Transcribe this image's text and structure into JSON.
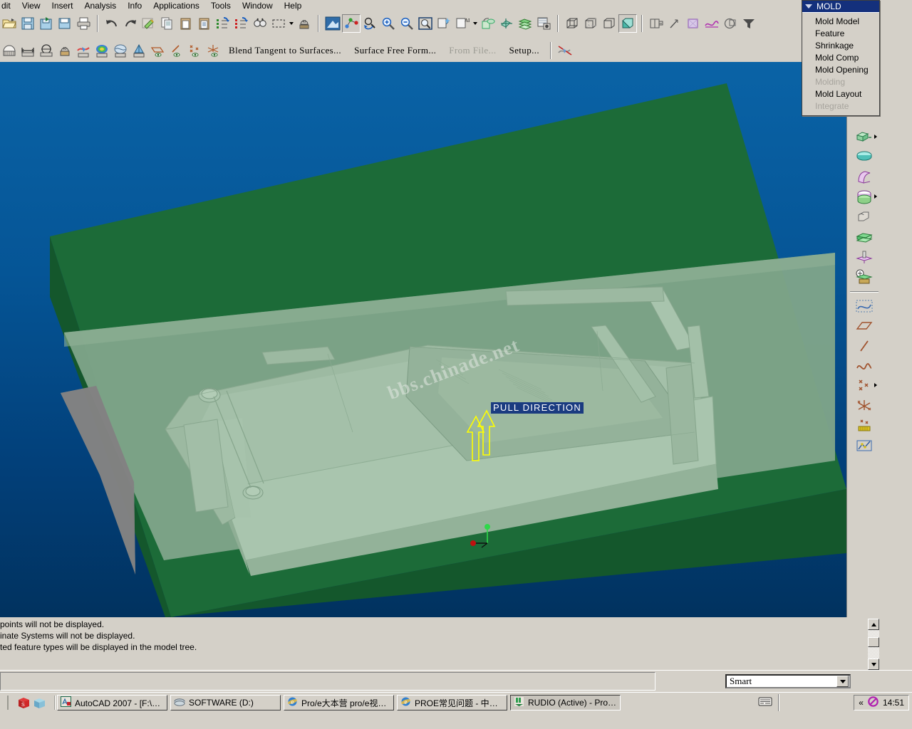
{
  "menubar": {
    "items": [
      {
        "label": "dit",
        "accel": ""
      },
      {
        "label": "View",
        "accel": "V"
      },
      {
        "label": "Insert",
        "accel": "I"
      },
      {
        "label": "Analysis",
        "accel": "A"
      },
      {
        "label": "Info",
        "accel": "n"
      },
      {
        "label": "Applications",
        "accel": "p"
      },
      {
        "label": "Tools",
        "accel": "T"
      },
      {
        "label": "Window",
        "accel": "W"
      },
      {
        "label": "Help",
        "accel": "H"
      }
    ]
  },
  "toolbar_top": {
    "icons": [
      {
        "name": "open-icon"
      },
      {
        "name": "save-icon"
      },
      {
        "name": "save-as-icon"
      },
      {
        "name": "save-copy-icon"
      },
      {
        "name": "print-icon"
      },
      {
        "name": "undo-icon"
      },
      {
        "name": "redo-icon"
      },
      {
        "name": "cut-icon"
      },
      {
        "name": "copy-icon"
      },
      {
        "name": "paste-icon"
      },
      {
        "name": "paste-special-icon"
      },
      {
        "name": "regenerate-icon"
      },
      {
        "name": "regenerate-manual-icon"
      },
      {
        "name": "find-icon"
      },
      {
        "name": "select-box-icon"
      },
      {
        "name": "measure-icon"
      },
      {
        "name": "repaint-icon"
      },
      {
        "name": "spin-center-icon"
      },
      {
        "name": "reorient-icon"
      },
      {
        "name": "zoom-in-icon"
      },
      {
        "name": "zoom-out-icon"
      },
      {
        "name": "refit-icon"
      },
      {
        "name": "saved-view-icon"
      },
      {
        "name": "annotation-icon"
      },
      {
        "name": "layer-icon"
      },
      {
        "name": "appearance-icon"
      },
      {
        "name": "view-manager-icon"
      },
      {
        "name": "render-icon"
      },
      {
        "name": "wireframe-icon"
      },
      {
        "name": "hidden-line-icon"
      },
      {
        "name": "no-hidden-icon"
      },
      {
        "name": "shaded-icon"
      },
      {
        "name": "datum-plane-icon"
      },
      {
        "name": "datum-axis-icon"
      },
      {
        "name": "datum-point-icon"
      },
      {
        "name": "datum-csys-icon"
      },
      {
        "name": "annotation-toggle-icon"
      },
      {
        "name": "filter-icon"
      }
    ]
  },
  "toolbar_second": {
    "icons": [
      {
        "name": "curvature-icon"
      },
      {
        "name": "distance-icon"
      },
      {
        "name": "diameter-icon"
      },
      {
        "name": "mass-properties-icon"
      },
      {
        "name": "draft-check-icon"
      },
      {
        "name": "curvature-plot-icon"
      },
      {
        "name": "surface-analysis-icon"
      },
      {
        "name": "shaded-curvature-icon"
      },
      {
        "name": "datum-plane-display-icon"
      },
      {
        "name": "datum-axis-display-icon"
      },
      {
        "name": "datum-point-display-icon"
      },
      {
        "name": "datum-csys-display-icon"
      }
    ],
    "text_items": [
      {
        "label": "Blend Tangent to Surfaces...",
        "dim": false
      },
      {
        "label": "Surface Free Form...",
        "dim": false
      },
      {
        "label": "From File...",
        "dim": true
      },
      {
        "label": "Setup...",
        "dim": false
      }
    ],
    "trailing_icon": "no-display-icon"
  },
  "mold_menu": {
    "title": "MOLD",
    "items": [
      {
        "label": "Mold Model",
        "enabled": true
      },
      {
        "label": "Feature",
        "enabled": true
      },
      {
        "label": "Shrinkage",
        "enabled": true
      },
      {
        "label": "Mold Comp",
        "enabled": true
      },
      {
        "label": "Mold Opening",
        "enabled": true
      },
      {
        "label": "Molding",
        "enabled": false
      },
      {
        "label": "Mold Layout",
        "enabled": true
      },
      {
        "label": "Integrate",
        "enabled": false
      }
    ]
  },
  "graphics": {
    "pull_direction_label": "PULL DIRECTION",
    "watermark": "bbs.chinade.net",
    "background_top_color": "#0a63a6",
    "background_bottom_color": "#01325f",
    "workpiece_color": "#1a6b39",
    "part_color": "#8fb196",
    "arrow_color": "#ffff00",
    "label_bg_color": "#1a3b80",
    "csys_axis_red": "#c80000",
    "csys_axis_green": "#20e040"
  },
  "right_toolbar": {
    "icons": [
      {
        "name": "extrude-icon",
        "flyout": true
      },
      {
        "name": "revolve-icon",
        "flyout": false
      },
      {
        "name": "sweep-icon",
        "flyout": false
      },
      {
        "name": "blend-icon",
        "flyout": true
      },
      {
        "name": "round-icon",
        "flyout": false
      },
      {
        "name": "rib-icon",
        "flyout": false
      },
      {
        "name": "draft-icon",
        "flyout": false
      },
      {
        "name": "shell-icon",
        "flyout": false
      },
      {
        "name": "sketch-icon",
        "flyout": false
      },
      {
        "name": "datum-plane-icon",
        "flyout": false
      },
      {
        "name": "datum-axis-icon",
        "flyout": false
      },
      {
        "name": "curve-icon",
        "flyout": false
      },
      {
        "name": "datum-point-icon",
        "flyout": true
      },
      {
        "name": "datum-csys-icon",
        "flyout": false
      },
      {
        "name": "reference-point-icon",
        "flyout": false
      },
      {
        "name": "graph-icon",
        "flyout": false
      }
    ]
  },
  "message_log": {
    "lines": [
      " points will not be displayed.",
      "inate Systems will not be displayed.",
      "ted feature types will be displayed in the model tree."
    ]
  },
  "status_bar": {
    "message": "",
    "filter_value": "Smart"
  },
  "taskbar": {
    "quick_launch": [
      {
        "name": "show-desktop-icon"
      },
      {
        "name": "solidworks-icon"
      },
      {
        "name": "media-icon"
      }
    ],
    "tasks": [
      {
        "label": "AutoCAD 2007 - [F:\\产...",
        "icon": "autocad-icon",
        "active": false
      },
      {
        "label": "SOFTWARE (D:)",
        "icon": "folder-drive-icon",
        "active": false
      },
      {
        "label": "Pro/e大本营 pro/e视频...",
        "icon": "ie-icon",
        "active": false
      },
      {
        "label": "PROE常见问题 - 中华...",
        "icon": "ie-icon",
        "active": false
      },
      {
        "label": "RUDIO (Active) - Pro/EN...",
        "icon": "proe-icon",
        "active": true
      }
    ],
    "tray": {
      "chevron": "«",
      "clock": "14:51",
      "icons": [
        {
          "name": "keyboard-icon"
        },
        {
          "name": "blocked-icon"
        }
      ]
    }
  }
}
